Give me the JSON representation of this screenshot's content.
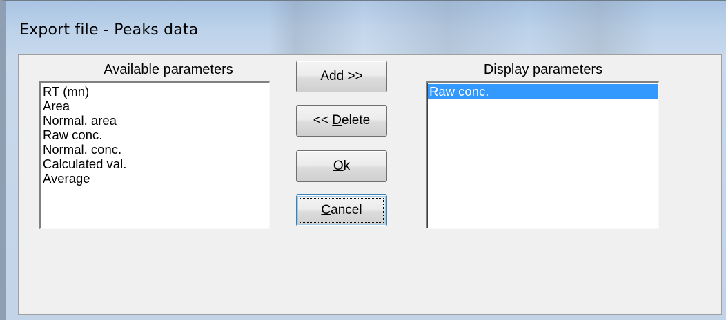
{
  "window": {
    "title": "Export file - Peaks data"
  },
  "available": {
    "label": "Available parameters",
    "items": [
      "RT (mn)",
      "Area",
      "Normal. area",
      "Raw conc.",
      "Normal. conc.",
      "Calculated val.",
      "Average"
    ]
  },
  "display": {
    "label": "Display parameters",
    "items": [
      "Raw conc."
    ],
    "selected_index": 0
  },
  "buttons": {
    "add": {
      "mnemonic": "A",
      "rest": "dd >>",
      "label": "Add >>"
    },
    "delete": {
      "prefix": "<< ",
      "mnemonic": "D",
      "rest": "elete",
      "label": "<< Delete"
    },
    "ok": {
      "mnemonic": "O",
      "rest": "k",
      "label": "Ok"
    },
    "cancel": {
      "mnemonic": "C",
      "rest": "ancel",
      "label": "Cancel"
    }
  },
  "colors": {
    "selection": "#3399ff",
    "dialog_bg": "#f0f0f0",
    "titlebar": "#bcd2ea"
  }
}
